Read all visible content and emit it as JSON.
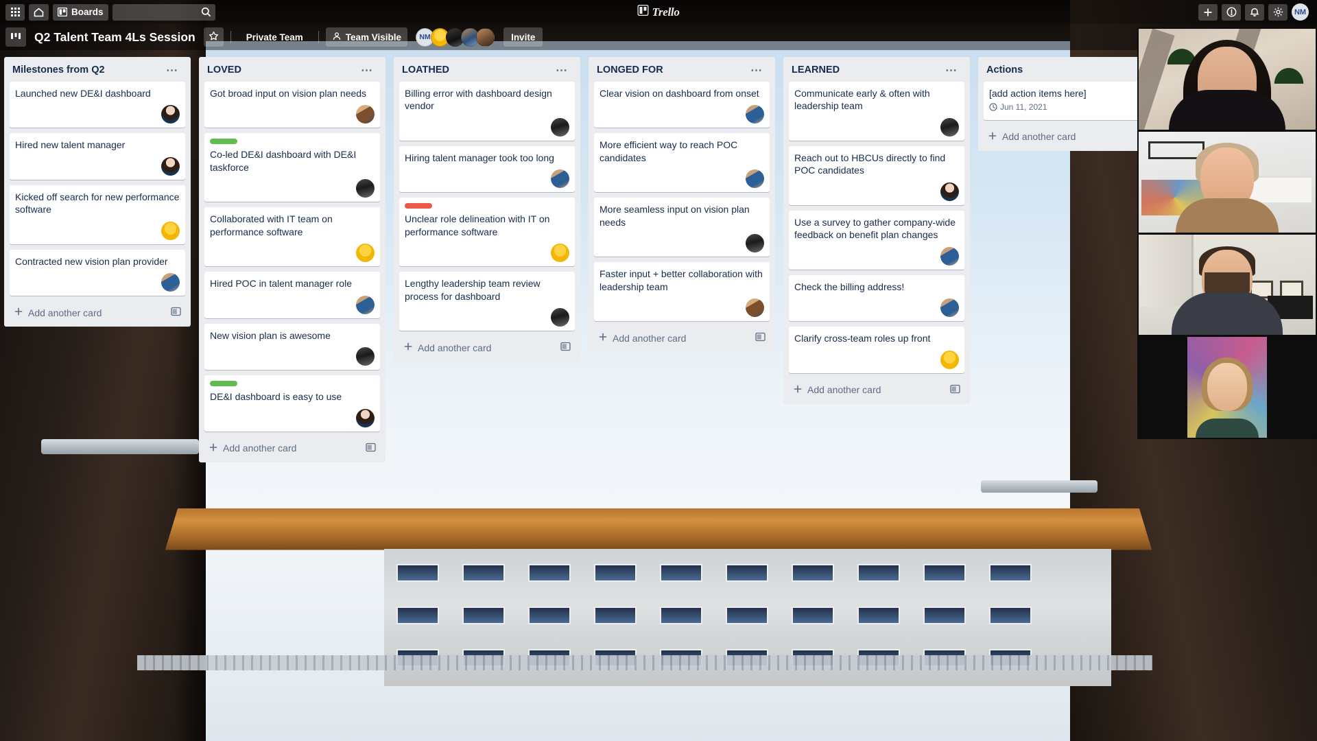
{
  "topnav": {
    "apps_icon": "grid-apps-icon",
    "home_icon": "home-icon",
    "boards_label": "Boards",
    "boards_icon": "board-icon",
    "search_placeholder": "",
    "search_value": "",
    "search_icon": "search-icon",
    "logo_text": "Trello",
    "logo_icon": "trello-logo-icon",
    "add_icon": "plus-icon",
    "info_icon": "info-icon",
    "notifications_icon": "bell-icon",
    "settings_icon": "gear-icon",
    "profile_initials": "NM"
  },
  "boardbar": {
    "board_icon": "board-switch-icon",
    "title": "Q2 Talent Team 4Ls Session",
    "star_icon": "star-icon",
    "team_label": "Private Team",
    "visibility_label": "Team Visible",
    "visibility_icon": "team-visible-icon",
    "member_initials": "NM",
    "invite_label": "Invite"
  },
  "add_card_label": "Add another card",
  "add_card_plus_icon": "plus-icon",
  "add_card_template_icon": "card-template-icon",
  "list_menu_icon": "ellipsis-icon",
  "labels": {
    "green": "#61bd4f",
    "red": "#eb5a46"
  },
  "lists": [
    {
      "title": "Milestones from Q2",
      "cards": [
        {
          "text": "Launched new DE&I dashboard",
          "avatar": "a-maria"
        },
        {
          "text": "Hired new talent manager",
          "avatar": "a-maria"
        },
        {
          "text": "Kicked off search for new performance software",
          "avatar": "a-yellow"
        },
        {
          "text": "Contracted new vision plan provider",
          "avatar": "a-blue"
        }
      ]
    },
    {
      "title": "LOVED",
      "cards": [
        {
          "text": "Got broad input on vision plan needs",
          "avatar": "a-warm"
        },
        {
          "text": "Co-led DE&I dashboard with DE&I taskforce",
          "avatar": "a-dark",
          "label": "green"
        },
        {
          "text": "Collaborated with IT team on performance software",
          "avatar": "a-yellow"
        },
        {
          "text": "Hired POC in talent manager role",
          "avatar": "a-blue"
        },
        {
          "text": "New vision plan is awesome",
          "avatar": "a-dark"
        },
        {
          "text": "DE&I dashboard is easy to use",
          "avatar": "a-maria",
          "label": "green"
        }
      ]
    },
    {
      "title": "LOATHED",
      "cards": [
        {
          "text": "Billing error with dashboard design vendor",
          "avatar": "a-dark"
        },
        {
          "text": "Hiring talent manager took too long",
          "avatar": "a-blue"
        },
        {
          "text": "Unclear role delineation with IT on performance software",
          "avatar": "a-yellow",
          "label": "red"
        },
        {
          "text": "Lengthy leadership team review process for dashboard",
          "avatar": "a-dark"
        }
      ]
    },
    {
      "title": "LONGED FOR",
      "cards": [
        {
          "text": "Clear vision on dashboard from onset",
          "avatar": "a-blue"
        },
        {
          "text": "More efficient way to reach POC candidates",
          "avatar": "a-blue"
        },
        {
          "text": "More seamless input on vision plan needs",
          "avatar": "a-dark"
        },
        {
          "text": "Faster input + better collaboration with leadership team",
          "avatar": "a-warm"
        }
      ]
    },
    {
      "title": "LEARNED",
      "cards": [
        {
          "text": "Communicate early & often with leadership team",
          "avatar": "a-dark"
        },
        {
          "text": "Reach out to HBCUs directly to find POC candidates",
          "avatar": "a-maria"
        },
        {
          "text": "Use a survey to gather company-wide feedback on benefit plan changes",
          "avatar": "a-blue"
        },
        {
          "text": "Check the billing address!",
          "avatar": "a-blue"
        },
        {
          "text": "Clarify cross-team roles up front",
          "avatar": "a-yellow"
        }
      ]
    },
    {
      "title": "Actions",
      "cards": [
        {
          "text": "[add action items here]",
          "due_date": "Jun 11, 2021",
          "due_icon": "clock-icon"
        }
      ]
    }
  ],
  "video_panel": {
    "tiles": [
      {
        "name": "participant-1"
      },
      {
        "name": "participant-2"
      },
      {
        "name": "participant-3"
      },
      {
        "name": "participant-4"
      }
    ]
  }
}
